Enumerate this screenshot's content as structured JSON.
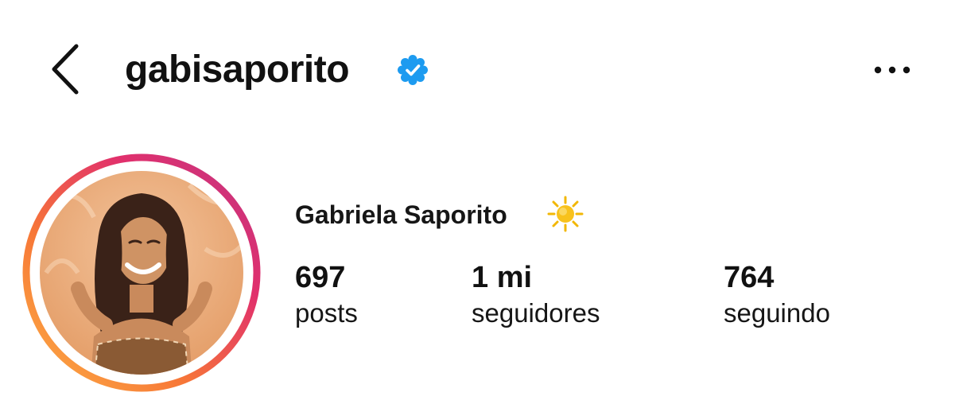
{
  "header": {
    "username": "gabisaporito",
    "verified_icon": "verified-badge-icon",
    "verified_color": "#1d9bf0",
    "back_icon": "chevron-left-icon",
    "more_icon": "more-horizontal-icon"
  },
  "profile": {
    "full_name": "Gabriela Saporito",
    "name_emoji_icon": "sun-icon",
    "avatar_ring_colors": [
      "#fcaf45",
      "#f77737",
      "#e1306c",
      "#c13584"
    ],
    "avatar_bg_color": "#e9a978"
  },
  "stats": [
    {
      "value": "697",
      "label": "posts"
    },
    {
      "value": "1 mi",
      "label": "seguidores"
    },
    {
      "value": "764",
      "label": "seguindo"
    }
  ]
}
